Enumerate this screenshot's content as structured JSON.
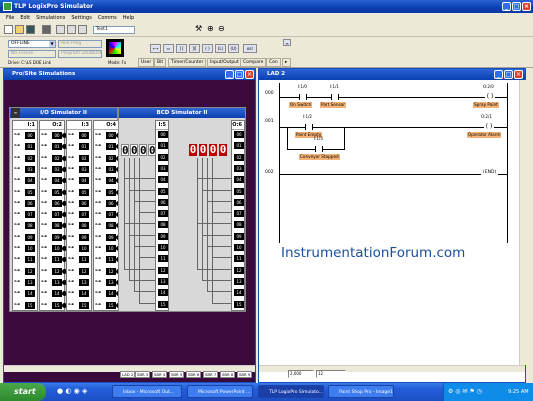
{
  "app": {
    "title": "TLP LogixPro Simulator"
  },
  "menu": [
    "File",
    "Edit",
    "Simulations",
    "Settings",
    "Comms",
    "Help"
  ],
  "toolbar": {
    "address_value": "Test1"
  },
  "mode": {
    "offline": "OFFLINE",
    "run": "Run Prog",
    "program": "Program Disabled",
    "status": "Drive: C:\\LS DOE Link",
    "mode_label": "Mode: Fx"
  },
  "instr_tabs": [
    "User",
    "Bit",
    "Timer/Counter",
    "Input/Output",
    "Compare",
    "Con"
  ],
  "io_sim": {
    "window_title": "Pro/Site Simulations",
    "title": "I/O Simulator II",
    "columns": [
      "I:1",
      "O:2",
      "I:3",
      "O:4"
    ],
    "rows": [
      "00",
      "01",
      "02",
      "03",
      "04",
      "05",
      "06",
      "07",
      "08",
      "09",
      "10",
      "11",
      "12",
      "13",
      "14",
      "15"
    ]
  },
  "bcd_sim": {
    "title": "BCD Simulator II",
    "col_left": "I:5",
    "col_right": "O:6",
    "input_digits": [
      "0",
      "0",
      "0",
      "0"
    ],
    "output_digits": [
      "0",
      "0",
      "0",
      "0"
    ]
  },
  "ladder": {
    "window_title": "LAD 2",
    "rungs": [
      {
        "num": "000",
        "contacts": [
          {
            "addr": "I:1/0",
            "label": "On Switch"
          },
          {
            "addr": "I:1/1",
            "label": "Part Sensor"
          }
        ],
        "coil": {
          "addr": "O:2/0",
          "label": "Spray Paint"
        }
      },
      {
        "num": "001",
        "contacts": [
          {
            "addr": "I:1/2",
            "label": "Paint Empty"
          },
          {
            "addr": "I:1/3",
            "label": "Conveyor Stopped"
          }
        ],
        "coil": {
          "addr": "O:2/1",
          "label": "Operator Alarm"
        }
      },
      {
        "num": "002",
        "end": "END"
      }
    ]
  },
  "watermark": "InstrumentationForum.com",
  "sheets": [
    "LAD 2",
    "SBR 3",
    "SBR 4",
    "SBR 5",
    "SBR 6",
    "SBR 7",
    "SBR 8",
    "SBR 9"
  ],
  "status": {
    "cell1": "2,000",
    "cell2": "12"
  },
  "taskbar": {
    "start": "start",
    "tasks": [
      "Inbox - Microsoft Out...",
      "Microsoft PowerPoint ...",
      "TLP LogixPro Simulato...",
      "Paint Shop Pro - Image1"
    ],
    "clock": "9:25 AM"
  }
}
